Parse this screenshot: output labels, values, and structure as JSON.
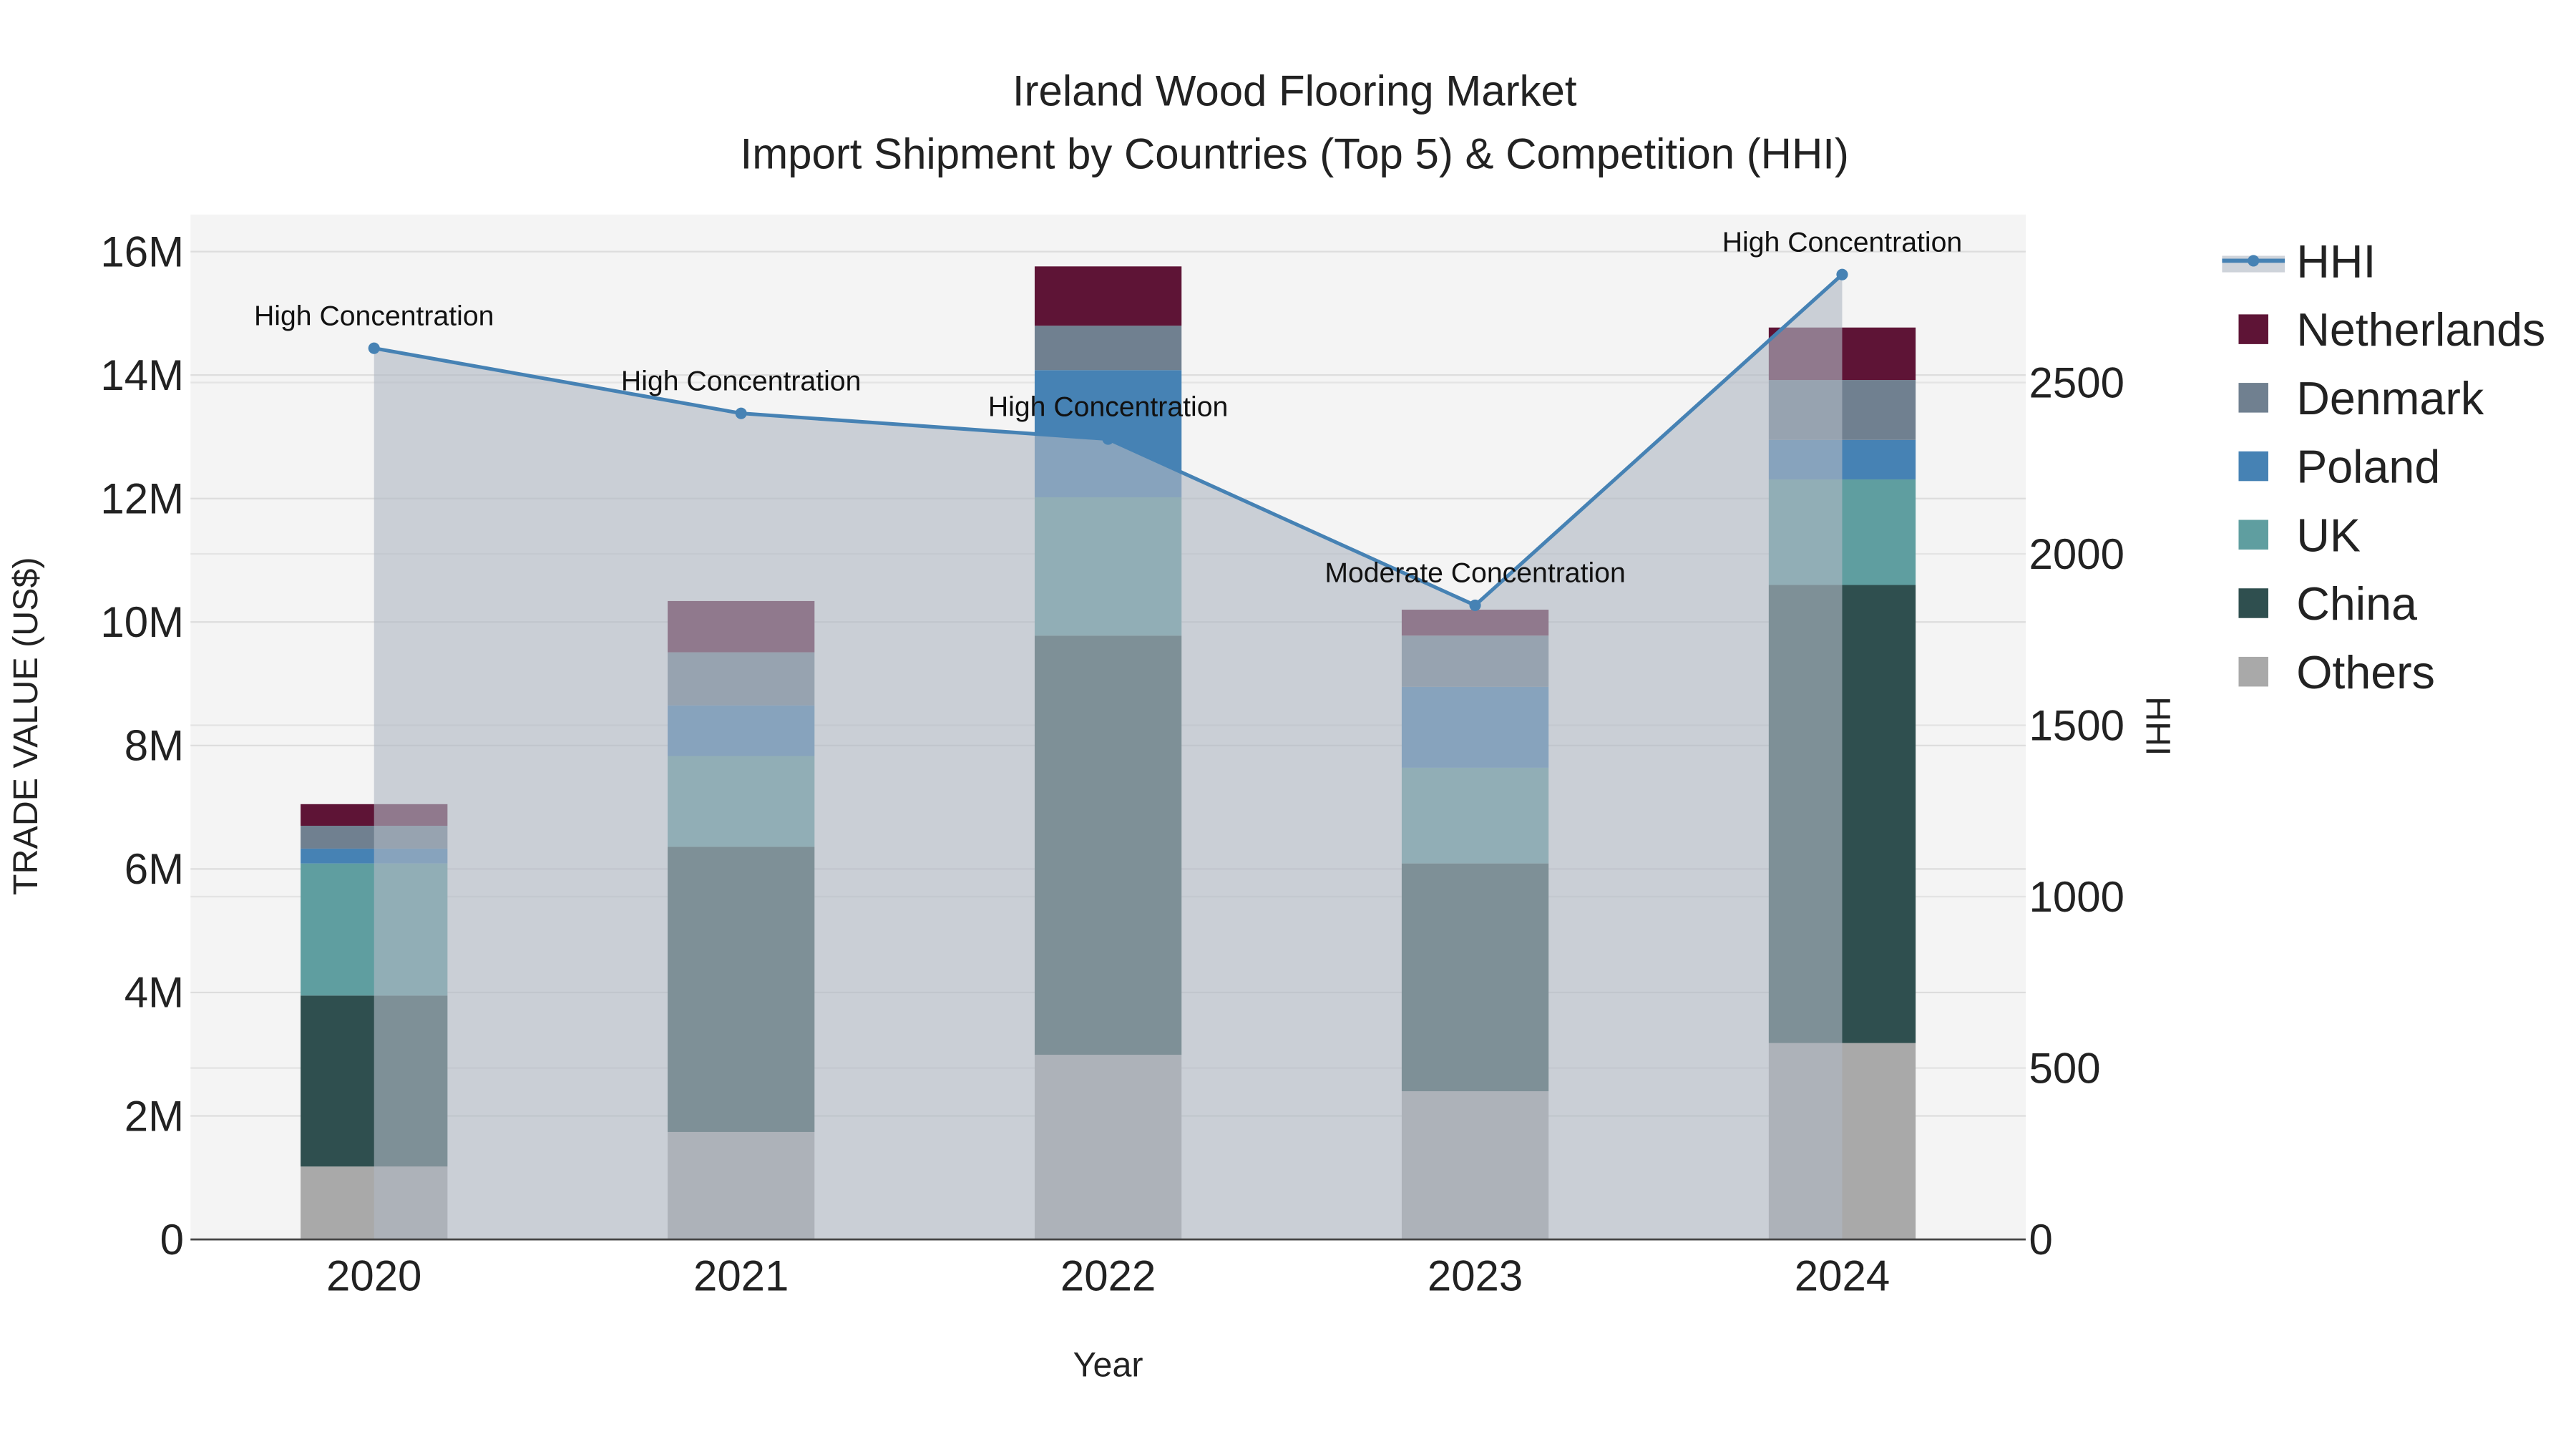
{
  "chart_data": {
    "type": "bar",
    "stacked": true,
    "title": "Ireland Wood Flooring Market",
    "subtitle": "Import Shipment by Countries (Top 5) & Competition (HHI)",
    "xlabel": "Year",
    "ylabel": "TRADE VALUE (US$)",
    "y2label": "HHI",
    "categories": [
      "2020",
      "2021",
      "2022",
      "2023",
      "2024"
    ],
    "ylim": [
      0,
      16600000
    ],
    "y2lim": [
      0,
      2990
    ],
    "yticks": [
      0,
      2000000,
      4000000,
      6000000,
      8000000,
      10000000,
      12000000,
      14000000,
      16000000
    ],
    "ytick_labels": [
      "0",
      "2M",
      "4M",
      "6M",
      "8M",
      "10M",
      "12M",
      "14M",
      "16M"
    ],
    "y2ticks": [
      0,
      500,
      1000,
      1500,
      2000,
      2500
    ],
    "y2tick_labels": [
      "0",
      "500",
      "1000",
      "1500",
      "2000",
      "2500"
    ],
    "series": [
      {
        "name": "Others",
        "color": "#a9a9a9",
        "values": [
          1180000,
          1740000,
          2990000,
          2400000,
          3180000
        ]
      },
      {
        "name": "China",
        "color": "#2f4f4f",
        "values": [
          2770000,
          4620000,
          6790000,
          3690000,
          7420000
        ]
      },
      {
        "name": "UK",
        "color": "#5f9ea0",
        "values": [
          2140000,
          1470000,
          2240000,
          1550000,
          1710000
        ]
      },
      {
        "name": "Poland",
        "color": "#4682b4",
        "values": [
          240000,
          820000,
          2060000,
          1310000,
          640000
        ]
      },
      {
        "name": "Denmark",
        "color": "#708090",
        "values": [
          370000,
          860000,
          720000,
          830000,
          970000
        ]
      },
      {
        "name": "Netherlands",
        "color": "#5e1436",
        "values": [
          350000,
          830000,
          960000,
          420000,
          850000
        ]
      }
    ],
    "line": {
      "name": "HHI",
      "color": "#4682b4",
      "axis": "y2",
      "values": [
        2600,
        2410,
        2335,
        1850,
        2815
      ],
      "annotations": [
        "High Concentration",
        "High Concentration",
        "High Concentration",
        "Moderate Concentration",
        "High Concentration"
      ]
    },
    "legend": {
      "position": "right",
      "items": [
        "HHI",
        "Netherlands",
        "Denmark",
        "Poland",
        "UK",
        "China",
        "Others"
      ]
    },
    "grid": true
  }
}
